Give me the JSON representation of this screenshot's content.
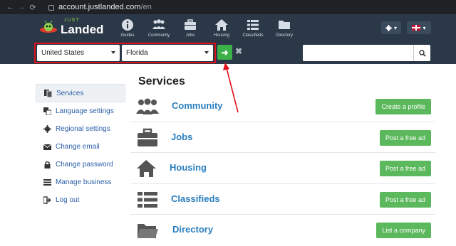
{
  "browser": {
    "url_host": "account.justlanded.com",
    "url_path": "/en",
    "back_icon": "←",
    "forward_icon": "→",
    "reload_icon": "⟳"
  },
  "header": {
    "logo_top": "JUST",
    "logo_main": "Landed",
    "nav": [
      {
        "label": "Guides",
        "icon": "info-icon"
      },
      {
        "label": "Community",
        "icon": "community-icon"
      },
      {
        "label": "Jobs",
        "icon": "briefcase-icon"
      },
      {
        "label": "Housing",
        "icon": "home-icon"
      },
      {
        "label": "Classifieds",
        "icon": "list-icon"
      },
      {
        "label": "Directory",
        "icon": "folder-icon"
      }
    ],
    "settings_icon": "gear-icon",
    "language_icon": "uk-flag-icon",
    "dropdown_caret": "▾"
  },
  "search": {
    "country": "United States",
    "region": "Florida",
    "go_icon": "➜",
    "clear_icon": "✖",
    "query_value": "",
    "query_placeholder": ""
  },
  "sidebar": {
    "items": [
      {
        "label": "Services",
        "icon": "services-icon",
        "active": true
      },
      {
        "label": "Language settings",
        "icon": "language-icon",
        "active": false
      },
      {
        "label": "Regional settings",
        "icon": "gear-icon",
        "active": false
      },
      {
        "label": "Change email",
        "icon": "envelope-icon",
        "active": false
      },
      {
        "label": "Change password",
        "icon": "lock-icon",
        "active": false
      },
      {
        "label": "Manage business",
        "icon": "business-icon",
        "active": false
      },
      {
        "label": "Log out",
        "icon": "logout-icon",
        "active": false
      }
    ]
  },
  "main": {
    "title": "Services",
    "services": [
      {
        "name": "Community",
        "button": "Create a profile",
        "icon": "community-icon"
      },
      {
        "name": "Jobs",
        "button": "Post a free ad",
        "icon": "briefcase-icon"
      },
      {
        "name": "Housing",
        "button": "Post a free ad",
        "icon": "home-icon"
      },
      {
        "name": "Classifieds",
        "button": "Post a free ad",
        "icon": "list-icon"
      },
      {
        "name": "Directory",
        "button": "List a company",
        "icon": "folder-icon"
      }
    ]
  },
  "colors": {
    "header_bg": "#2b3848",
    "accent_green": "#5cb85c",
    "link_blue": "#2b7fbf",
    "annotation_red": "#e0101a"
  }
}
